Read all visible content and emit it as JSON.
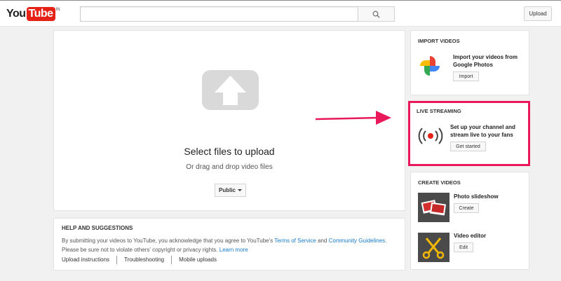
{
  "header": {
    "logo_you": "You",
    "logo_tube": "Tube",
    "logo_country": "IN",
    "search_placeholder": "",
    "upload_label": "Upload"
  },
  "upload": {
    "title": "Select files to upload",
    "subtitle": "Or drag and drop video files",
    "privacy_label": "Public"
  },
  "help": {
    "title": "HELP AND SUGGESTIONS",
    "text_part1": "By submitting your videos to YouTube, you acknowledge that you agree to YouTube's ",
    "terms_link": "Terms of Service",
    "text_part2": " and ",
    "guidelines_link": "Community Guidelines",
    "text_part3": ". Please be sure not to violate others' copyright or privacy rights. ",
    "learn_more_link": "Learn more",
    "links": [
      "Upload instructions",
      "Troubleshooting",
      "Mobile uploads"
    ]
  },
  "import_videos": {
    "title": "IMPORT VIDEOS",
    "text": "Import your videos from Google Photos",
    "button": "Import",
    "icon": "google-photos-icon"
  },
  "live_streaming": {
    "title": "LIVE STREAMING",
    "text": "Set up your channel and stream live to your fans",
    "button": "Get started",
    "icon": "live-broadcast-icon",
    "highlight_color": "#e8185a"
  },
  "create_videos": {
    "title": "CREATE VIDEOS",
    "items": [
      {
        "label": "Photo slideshow",
        "button": "Create",
        "icon": "photo-slideshow-icon"
      },
      {
        "label": "Video editor",
        "button": "Edit",
        "icon": "video-editor-icon"
      }
    ]
  },
  "colors": {
    "brand_red": "#e62117",
    "link_blue": "#167ac6",
    "annotation_pink": "#e8185a"
  }
}
